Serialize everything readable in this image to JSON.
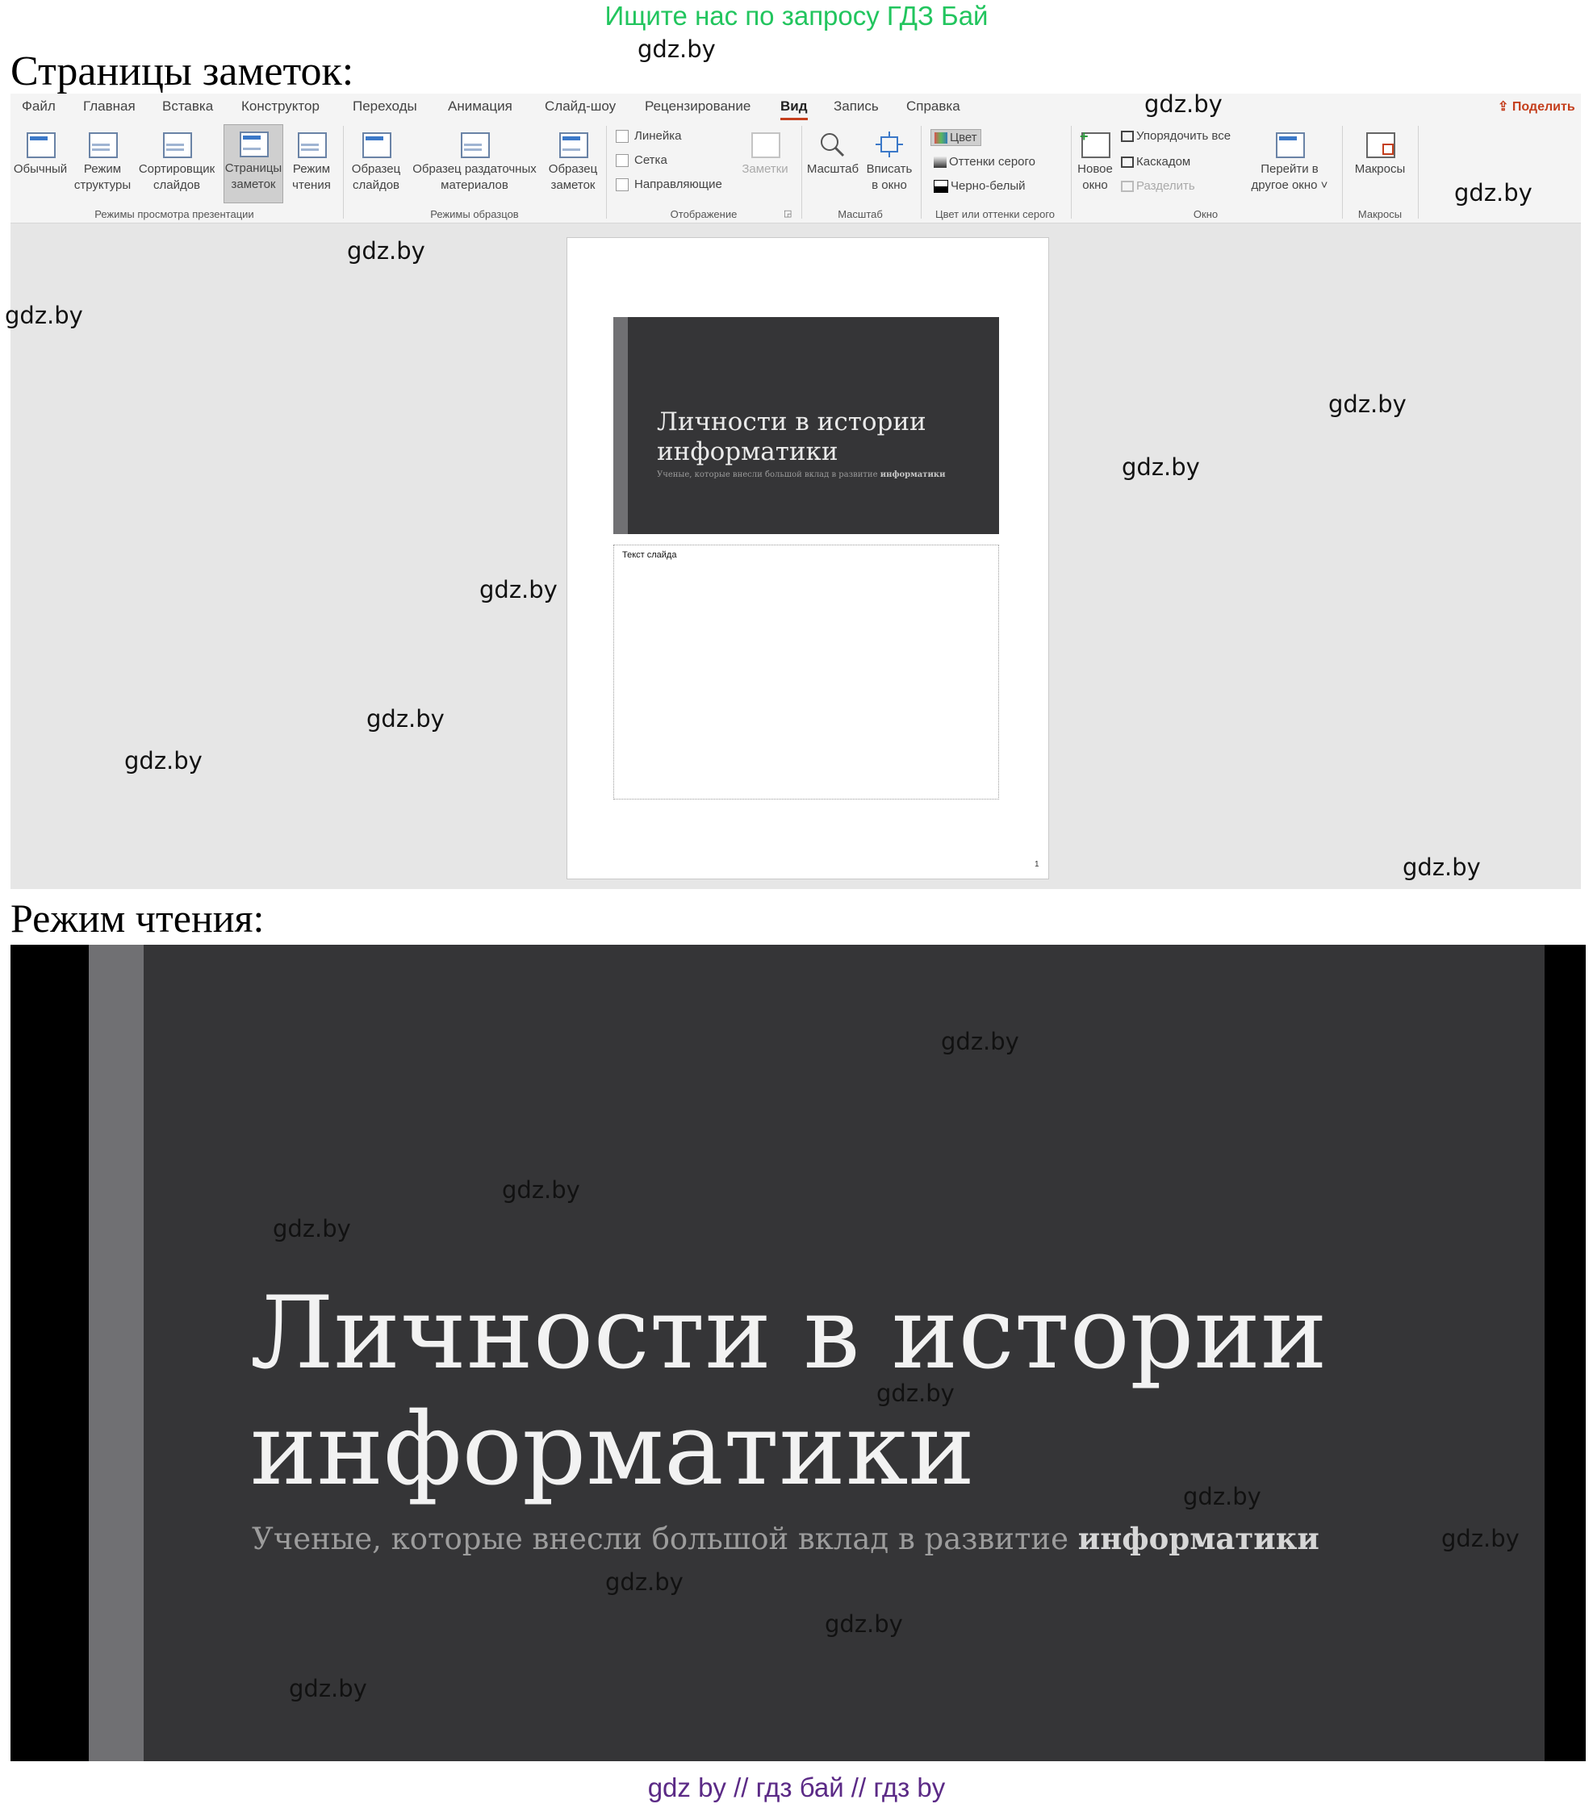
{
  "banner_top": "Ищите нас по запросу ГДЗ Бай",
  "section1_title": "Страницы заметок:",
  "section2_title": "Режим чтения:",
  "banner_bottom": "gdz by  //  гдз бай  //  гдз by",
  "watermark": "gdz.by",
  "ribbon": {
    "tabs": [
      "Файл",
      "Главная",
      "Вставка",
      "Конструктор",
      "Переходы",
      "Анимация",
      "Слайд-шоу",
      "Рецензирование",
      "Вид",
      "Запись",
      "Справка"
    ],
    "active_tab": "Вид",
    "share": "Поделить",
    "views": {
      "normal": [
        "Обычный",
        ""
      ],
      "outline": [
        "Режим",
        "структуры"
      ],
      "sorter": [
        "Сортировщик",
        "слайдов"
      ],
      "notes": [
        "Страницы",
        "заметок"
      ],
      "reading": [
        "Режим",
        "чтения"
      ],
      "group_label": "Режимы просмотра презентации"
    },
    "masters": {
      "slide": [
        "Образец",
        "слайдов"
      ],
      "handout": [
        "Образец раздаточных",
        "материалов"
      ],
      "notes": [
        "Образец",
        "заметок"
      ],
      "group_label": "Режимы образцов"
    },
    "show": {
      "ruler": "Линейка",
      "grid": "Сетка",
      "guides": "Направляющие",
      "notes": "Заметки",
      "group_label": "Отображение"
    },
    "zoom": {
      "zoom": "Масштаб",
      "fit": [
        "Вписать",
        "в окно"
      ],
      "group_label": "Масштаб"
    },
    "color": {
      "color": "Цвет",
      "grayscale": "Оттенки серого",
      "bw": "Черно-белый",
      "group_label": "Цвет или оттенки серого"
    },
    "window": {
      "new": [
        "Новое",
        "окно"
      ],
      "arrange": "Упорядочить все",
      "cascade": "Каскадом",
      "split": "Разделить",
      "switch": [
        "Перейти в",
        "другое окно ˅"
      ],
      "group_label": "Окно"
    },
    "macros": {
      "macros": "Макросы",
      "group_label": "Макросы"
    }
  },
  "slide": {
    "title": "Личности в истории информатики",
    "subtitle_plain": "Ученые, которые внесли большой вклад в развитие ",
    "subtitle_bold": "информатики"
  },
  "notes_page": {
    "notes_placeholder": "Текст слайда",
    "page_number": "1"
  },
  "colors": {
    "banner_top": "#22c55e",
    "banner_bottom": "#5b2a86",
    "slide_bg": "#353537",
    "slide_bar": "#707073",
    "accent": "#c43e1c"
  }
}
